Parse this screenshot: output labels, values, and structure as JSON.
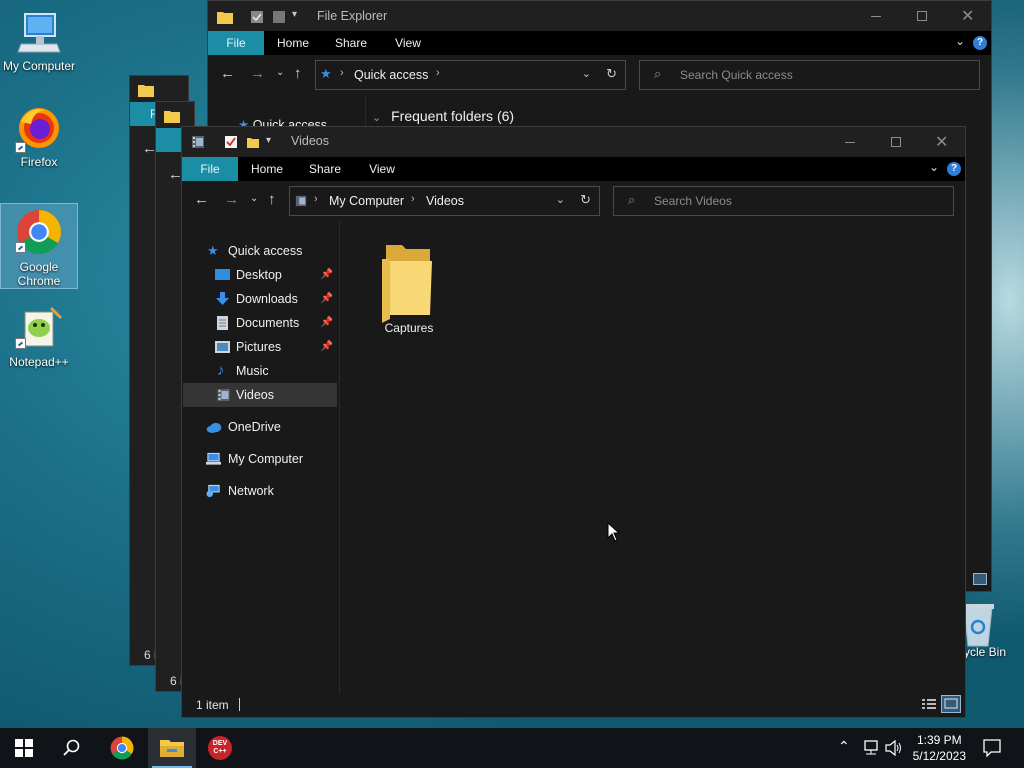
{
  "desktop": {
    "icons": [
      {
        "label": "My Computer",
        "icon": "computer-icon"
      },
      {
        "label": "Firefox",
        "icon": "firefox-icon"
      },
      {
        "label": "Google Chrome",
        "icon": "chrome-icon"
      },
      {
        "label": "Notepad++",
        "icon": "notepadpp-icon"
      },
      {
        "label": "cycle Bin",
        "icon": "recycle-bin-icon"
      }
    ]
  },
  "back_windows": {
    "file_explorer": {
      "title": "File Explorer",
      "tabs": [
        "File",
        "Home",
        "Share",
        "View"
      ],
      "breadcrumb": "Quick access",
      "search_placeholder": "Search Quick access",
      "sidebar_partial": "Quick access",
      "section_header": "Frequent folders (6)"
    },
    "window_2": {
      "tab_partial": "Fi",
      "status_partial": "6 i"
    },
    "window_3": {
      "tab_partial": "Fi",
      "status_partial": "6 i"
    }
  },
  "videos_window": {
    "title": "Videos",
    "tabs": [
      "File",
      "Home",
      "Share",
      "View"
    ],
    "breadcrumb": [
      "My Computer",
      "Videos"
    ],
    "search_placeholder": "Search Videos",
    "sidebar": [
      {
        "label": "Quick access",
        "icon": "star-icon"
      },
      {
        "label": "Desktop",
        "icon": "desktop-folder-icon",
        "pinned": true
      },
      {
        "label": "Downloads",
        "icon": "download-icon",
        "pinned": true
      },
      {
        "label": "Documents",
        "icon": "documents-icon",
        "pinned": true
      },
      {
        "label": "Pictures",
        "icon": "pictures-icon",
        "pinned": true
      },
      {
        "label": "Music",
        "icon": "music-icon"
      },
      {
        "label": "Videos",
        "icon": "videos-icon",
        "selected": true
      },
      {
        "label": "OneDrive",
        "icon": "cloud-icon"
      },
      {
        "label": "My Computer",
        "icon": "computer-icon"
      },
      {
        "label": "Network",
        "icon": "network-icon"
      }
    ],
    "items": [
      {
        "name": "Captures",
        "type": "folder"
      }
    ],
    "status": "1 item"
  },
  "taskbar": {
    "apps": [
      "start-icon",
      "search-icon",
      "chrome-icon",
      "file-explorer-icon",
      "devcpp-icon"
    ],
    "devcpp_text": "DEV\nC++",
    "clock": {
      "time": "1:39 PM",
      "date": "5/12/2023"
    }
  },
  "colors": {
    "accent": "#1b8ea6",
    "selection": "#353535",
    "window_bg": "#191919",
    "ribbon_bg": "#000000"
  }
}
